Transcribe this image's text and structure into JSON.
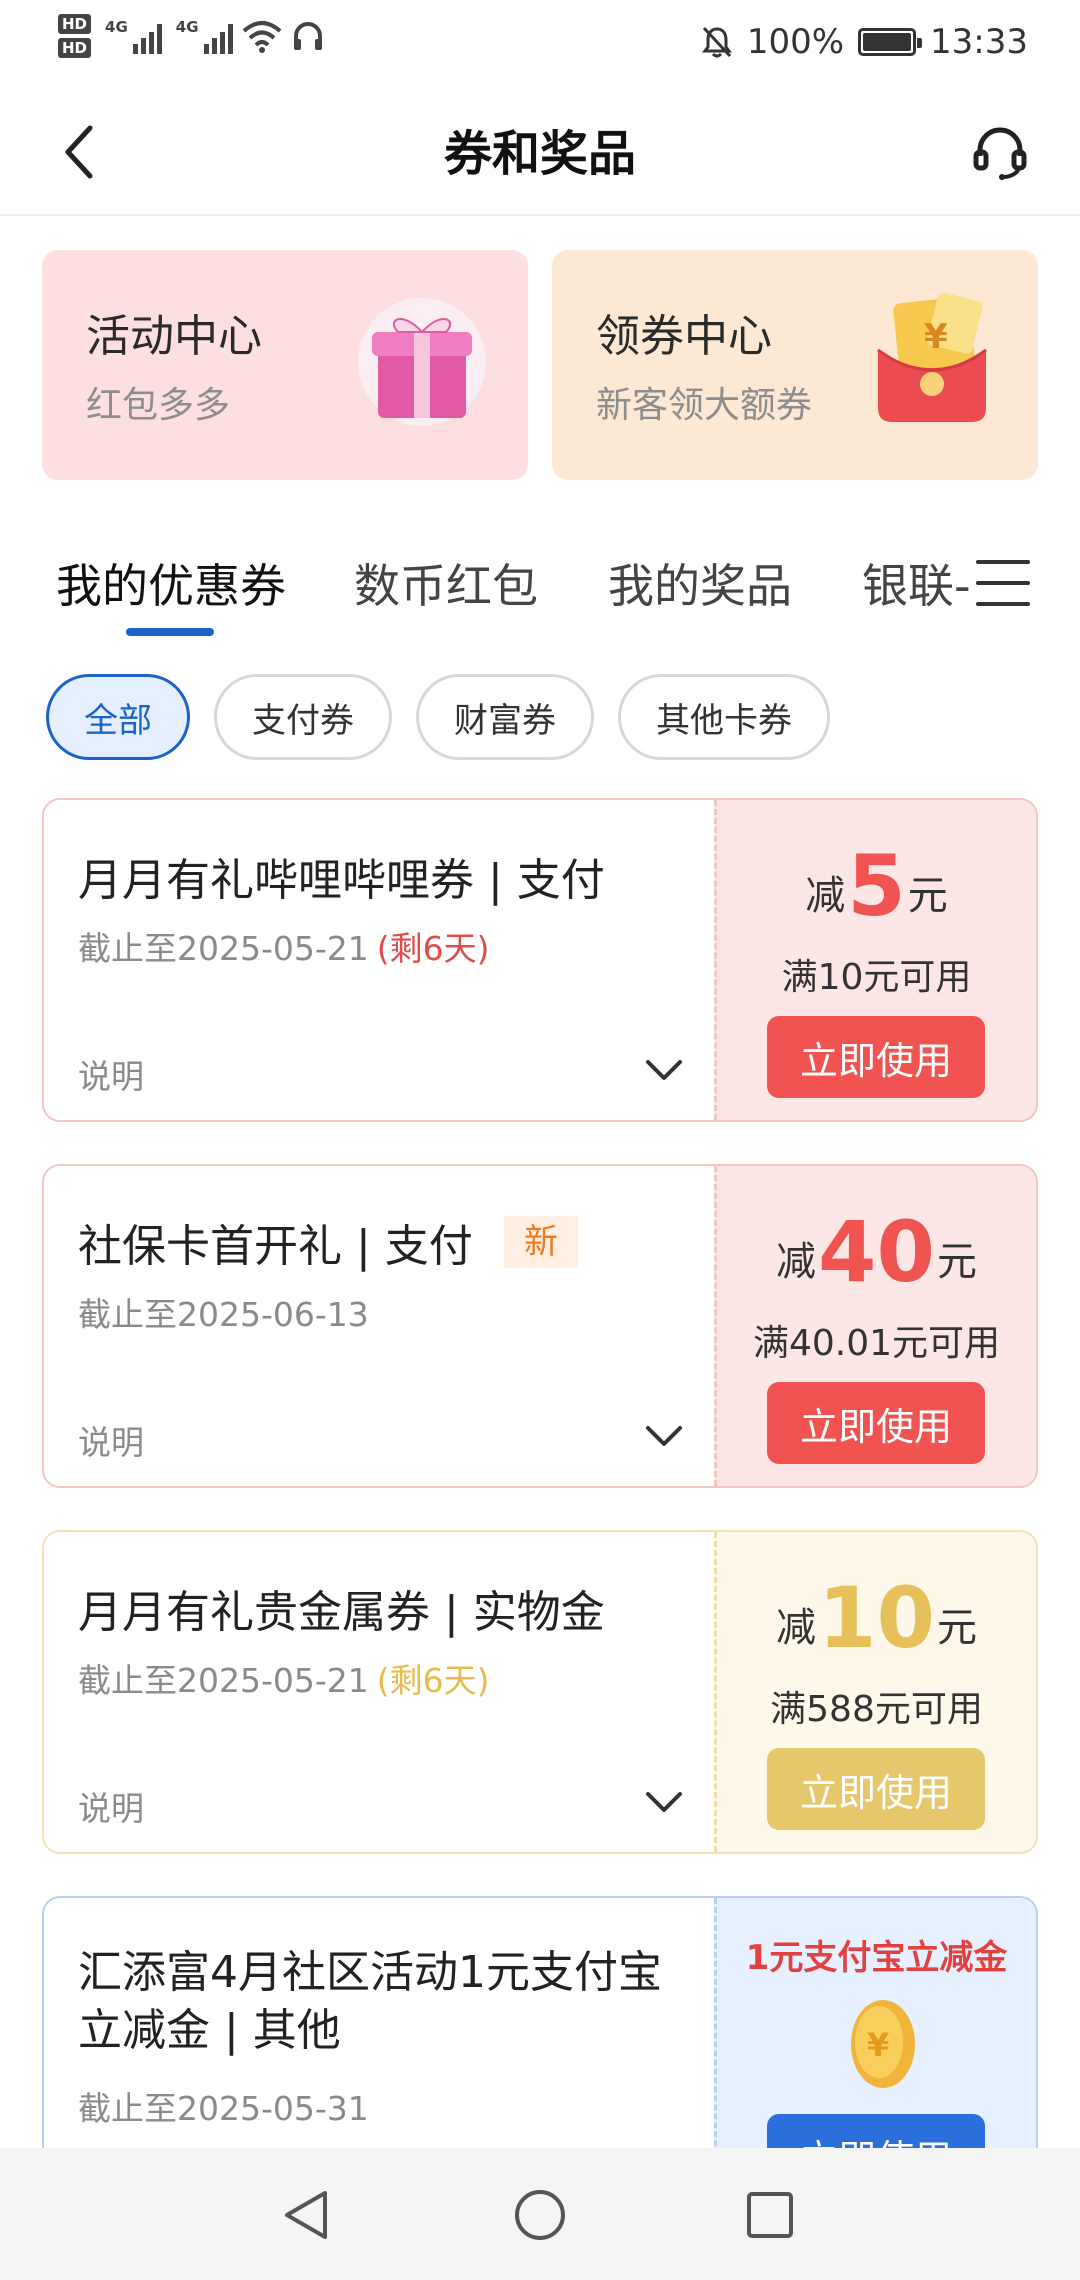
{
  "status_bar": {
    "hd1": "HD",
    "hd2": "HD",
    "net1": "4G",
    "net2": "4G",
    "battery_percent": "100%",
    "time": "13:33"
  },
  "header": {
    "title": "券和奖品"
  },
  "promos": [
    {
      "title": "活动中心",
      "subtitle": "红包多多"
    },
    {
      "title": "领券中心",
      "subtitle": "新客领大额券"
    }
  ],
  "tabs": [
    {
      "label": "我的优惠券",
      "active": true
    },
    {
      "label": "数币红包",
      "active": false
    },
    {
      "label": "我的奖品",
      "active": false
    },
    {
      "label": "银联-",
      "active": false
    }
  ],
  "filters": [
    {
      "label": "全部",
      "active": true
    },
    {
      "label": "支付券",
      "active": false
    },
    {
      "label": "财富券",
      "active": false
    },
    {
      "label": "其他卡券",
      "active": false
    }
  ],
  "coupons": [
    {
      "title": "月月有礼哔哩哔哩券 | 支付",
      "expiry": "截止至2025-05-21",
      "remaining": "(剩6天)",
      "note": "说明",
      "prefix": "减",
      "amount": "5",
      "unit": "元",
      "condition": "满10元可用",
      "button": "立即使用",
      "theme_color": "#f05350"
    },
    {
      "title": "社保卡首开礼 | 支付",
      "tag": "新",
      "expiry": "截止至2025-06-13",
      "note": "说明",
      "prefix": "减",
      "amount": "40",
      "unit": "元",
      "condition": "满40.01元可用",
      "button": "立即使用",
      "theme_color": "#f05350"
    },
    {
      "title": "月月有礼贵金属券 | 实物金",
      "expiry": "截止至2025-05-21",
      "remaining": "(剩6天)",
      "note": "说明",
      "prefix": "减",
      "amount": "10",
      "unit": "元",
      "condition": "满588元可用",
      "button": "立即使用",
      "theme_color": "#e6c76b"
    },
    {
      "title": "汇添富4月社区活动1元支付宝立减金 | 其他",
      "expiry": "截止至2025-05-31",
      "promo_label": "1元支付宝立减金",
      "button": "立即使用",
      "theme_color": "#2a6fdc"
    }
  ],
  "icons": {
    "back": "chevron-left-icon",
    "service": "headset-icon",
    "menu": "menu-icon",
    "gift": "gift-box-icon",
    "red_envelope": "red-envelope-icon",
    "coin": "gold-coin-icon"
  }
}
